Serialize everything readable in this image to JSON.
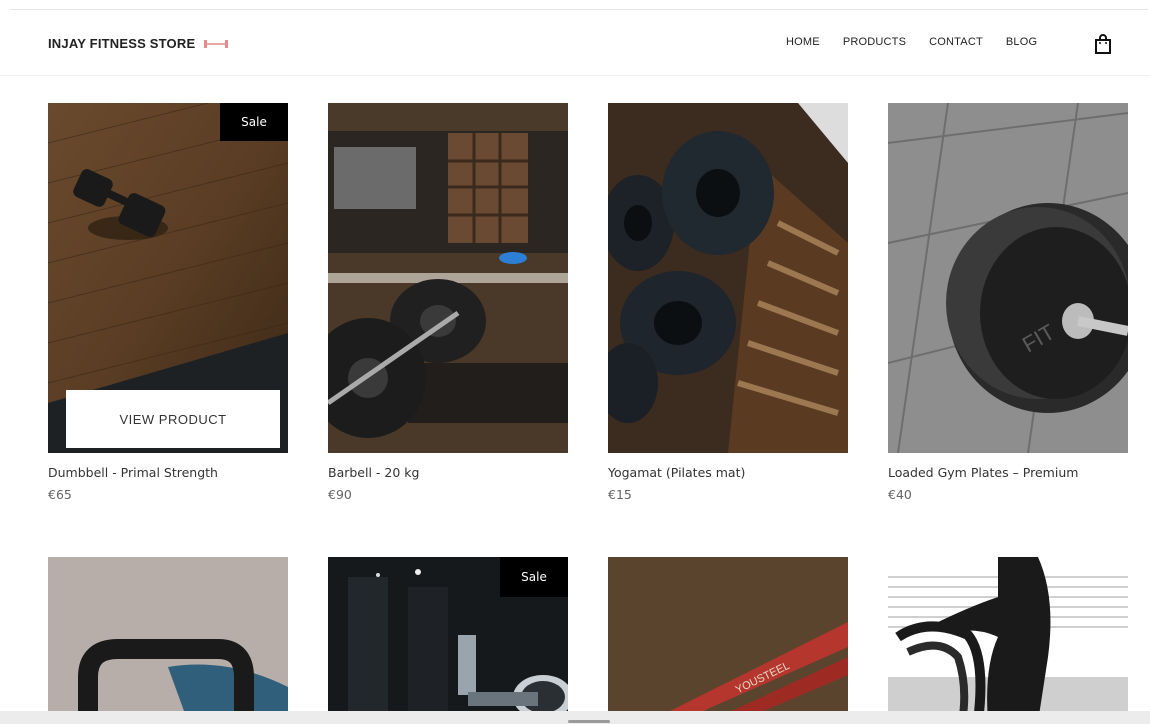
{
  "header": {
    "brand": "INJAY FITNESS STORE",
    "nav": [
      "HOME",
      "PRODUCTS",
      "CONTACT",
      "BLOG"
    ]
  },
  "products": [
    {
      "name": "Dumbbell - Primal Strength",
      "price": "€65",
      "badge": "Sale",
      "action": "VIEW PRODUCT"
    },
    {
      "name": "Barbell - 20 kg",
      "price": "€90"
    },
    {
      "name": "Yogamat (Pilates mat)",
      "price": "€15"
    },
    {
      "name": "Loaded Gym Plates – Premium",
      "price": "€40"
    }
  ],
  "products_row2": [
    {
      "badge": null
    },
    {
      "badge": "Sale",
      "image_text": ""
    },
    {
      "image_text": "YOUSTEEL"
    },
    {}
  ]
}
